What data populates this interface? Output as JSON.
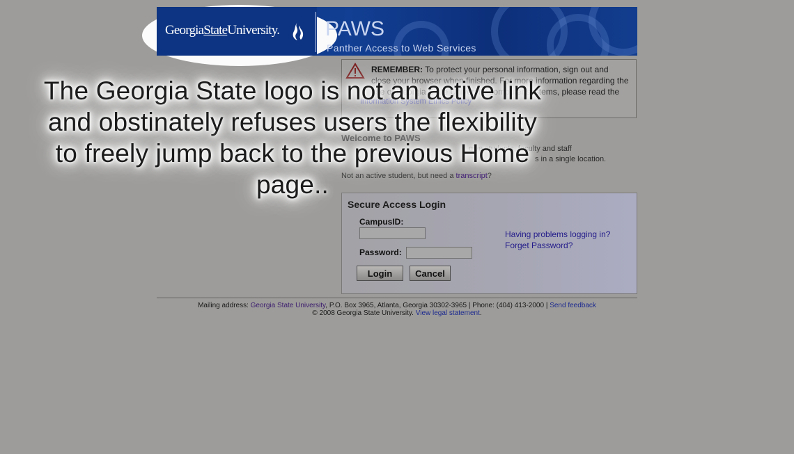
{
  "header": {
    "logo_text_pre": "Georgia",
    "logo_text_state": "State",
    "logo_text_post": "University.",
    "app_title": "PAWS",
    "app_subtitle": "Panther Access to Web Services"
  },
  "notice": {
    "heading": "REMEMBER:",
    "text": " To protect your personal information, sign out and close your browser when finished. For more information regarding the use of Georgia State University computer systems, please read the",
    "policy_link": "Information System Ethics Policy"
  },
  "welcome": {
    "title": "Welcome to PAWS",
    "text_right": "give students, faculty and staff",
    "text_right2": "s in a single location.",
    "text_left": "d",
    "transcript_prefix": "Not an active student, but need a ",
    "transcript_link": "transcript",
    "transcript_suffix": "?"
  },
  "login": {
    "title": "Secure Access Login",
    "campus_label": "CampusID:",
    "campus_value": "",
    "password_label": "Password:",
    "password_value": "",
    "login_button": "Login",
    "cancel_button": "Cancel",
    "help_link": "Having problems logging in?",
    "forgot_link": "Forget Password?"
  },
  "footer": {
    "mailing_prefix": "Mailing address: ",
    "gsu_link": "Georgia State University",
    "address": ", P.O. Box 3965, Atlanta, Georgia 30302-3965 | Phone: (404) 413-2000 | ",
    "feedback_link": "Send feedback",
    "copyright": "© 2008 Georgia State University. ",
    "legal_link": "View legal statement",
    "legal_suffix": "."
  },
  "overlay": {
    "caption": "The Georgia State logo is not an active link and obstinately refuses users the flexibility to freely jump back to the previous Home page.."
  },
  "colors": {
    "background": "#9d9c9a",
    "banner_blue": "#123f93",
    "link_blue": "#241c8a"
  },
  "icons": {
    "warning": "warning-triangle-icon",
    "logo_mark": "flame-icon"
  }
}
